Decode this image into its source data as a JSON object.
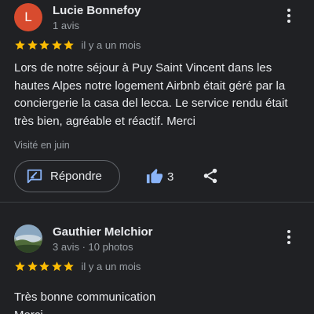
{
  "colors": {
    "star": "#fbbc04",
    "accent": "#8ab4f8",
    "avatar_letter_bg": "#d84b2e"
  },
  "reviews": [
    {
      "avatar_letter": "L",
      "author": "Lucie Bonnefoy",
      "meta": "1 avis",
      "rating": 5,
      "time": "il y a un mois",
      "text": "Lors de notre séjour à Puy Saint Vincent dans les hautes Alpes notre logement Airbnb était géré par la conciergerie la casa del lecca. Le service rendu était très bien, agréable et réactif. Merci",
      "visited": "Visité en juin",
      "reply_label": "Répondre",
      "like_count": "3"
    },
    {
      "author": "Gauthier Melchior",
      "meta": "3 avis · 10 photos",
      "rating": 5,
      "time": "il y a un mois",
      "text": "Très bonne communication\nMerci"
    }
  ]
}
